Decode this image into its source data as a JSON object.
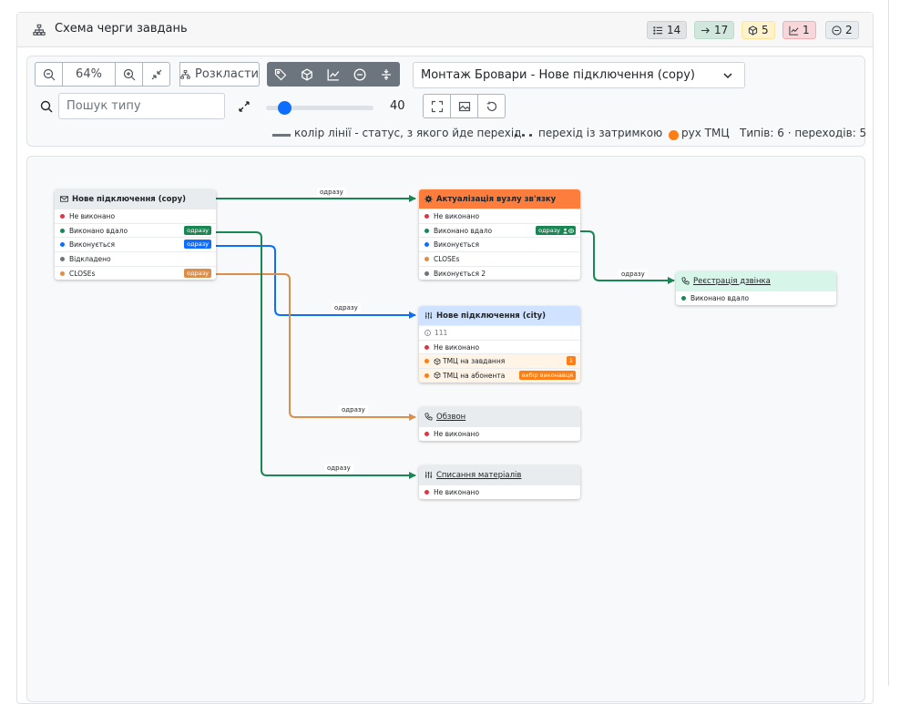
{
  "header": {
    "title": "Схема черги завдань",
    "badges": [
      {
        "icon": "list-icon",
        "value": "14",
        "bg": "#e2e3e5"
      },
      {
        "icon": "arrow-right-icon",
        "value": "17",
        "bg": "#d1e7dd"
      },
      {
        "icon": "box-icon",
        "value": "5",
        "bg": "#fff3cd"
      },
      {
        "icon": "chart-line-icon",
        "value": "1",
        "bg": "#f8d7da"
      },
      {
        "icon": "minus-circle-icon",
        "value": "2",
        "bg": "#e9ecef"
      }
    ]
  },
  "toolbar": {
    "zoom": "64%",
    "layout_label": "Розкласти",
    "select_value": "Монтаж Бровари - Нове підключення (copy)",
    "search_placeholder": "Пошук типу",
    "slider_value": "40",
    "slider_fraction": 0.13,
    "legend": {
      "line_color": "колір лінії - статус, з якого йде перехід",
      "delay": "перехід із затримкою",
      "tmc": "рух ТМЦ",
      "counts": "Типів: 6 · переходів: 5"
    }
  },
  "colors": {
    "green": "#198754",
    "blue": "#0d6efd",
    "orange": "#dc8f4a",
    "red": "#dc3545",
    "gray": "#6c757d"
  },
  "nodes": {
    "copy": {
      "title": "Нове підключення (copy)",
      "rows": [
        {
          "label": "Не виконано",
          "dot": "#dc3545"
        },
        {
          "label": "Виконано вдало",
          "dot": "#198754",
          "pill": "одразу",
          "pill_bg": "#198754"
        },
        {
          "label": "Виконується",
          "dot": "#0d6efd",
          "pill": "одразу",
          "pill_bg": "#0d6efd"
        },
        {
          "label": "Відкладено",
          "dot": "#6c757d"
        },
        {
          "label": "CLOSEs",
          "dot": "#dc8f4a",
          "pill": "одразу",
          "pill_bg": "#dc8f4a"
        }
      ]
    },
    "update": {
      "title": "Актуалізація вузлу зв'язку",
      "rows": [
        {
          "label": "Не виконано",
          "dot": "#dc3545"
        },
        {
          "label": "Виконано вдало",
          "dot": "#198754",
          "pill": "одразу",
          "pill_bg": "#198754"
        },
        {
          "label": "Виконується",
          "dot": "#0d6efd"
        },
        {
          "label": "CLOSEs",
          "dot": "#dc8f4a"
        },
        {
          "label": "Виконується 2",
          "dot": "#6c757d"
        }
      ]
    },
    "register": {
      "title": "Реєстрація дзвінка",
      "rows": [
        {
          "label": "Виконано вдало",
          "dot": "#198754"
        }
      ]
    },
    "city": {
      "title": "Нове підключення (city)",
      "info": "111",
      "rows": [
        {
          "label": "Не виконано",
          "dot": "#dc3545"
        },
        {
          "label": "ТМЦ на завдання",
          "dot": "#fd7e14",
          "pill": "1",
          "pill_bg": "#fd7e14"
        },
        {
          "label": "ТМЦ на абонента",
          "dot": "#fd7e14",
          "pill": "вибір виконавця",
          "pill_bg": "#fd7e14"
        }
      ]
    },
    "call": {
      "title": "Обзвон",
      "rows": [
        {
          "label": "Не виконано",
          "dot": "#dc3545"
        }
      ]
    },
    "writeoff": {
      "title": "Списання матеріалів",
      "rows": [
        {
          "label": "Не виконано",
          "dot": "#dc3545"
        }
      ]
    }
  },
  "edge_labels": [
    "одразу",
    "одразу",
    "одразу",
    "одразу",
    "одразу"
  ]
}
